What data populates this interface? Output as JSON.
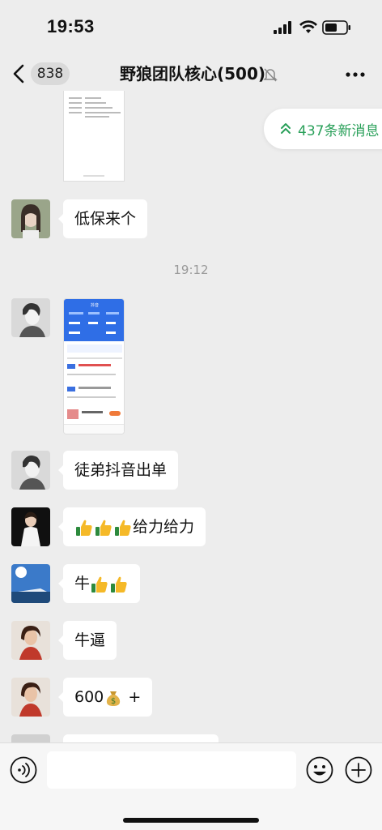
{
  "status_bar": {
    "time": "19:53"
  },
  "nav": {
    "unread_count": "838",
    "title": "野狼团队核心(500)"
  },
  "new_messages": {
    "label": "437条新消息"
  },
  "timestamp": "19:12",
  "messages": [
    {
      "text": "低保来个"
    },
    {
      "text": "徒弟抖音出单"
    },
    {
      "text": "给力给力"
    },
    {
      "text": "牛"
    },
    {
      "text": "牛逼"
    },
    {
      "text": "600"
    },
    {
      "text": "+"
    }
  ],
  "screenshot_card": {
    "title": "抖音"
  },
  "colors": {
    "accent_green": "#2aa05a",
    "background": "#ededed",
    "bubble": "#ffffff"
  }
}
